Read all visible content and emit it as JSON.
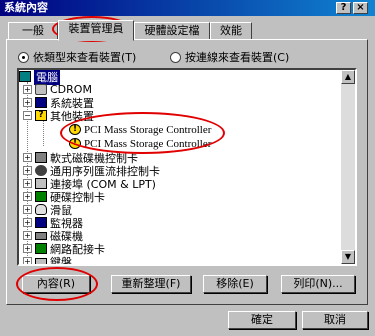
{
  "window": {
    "title": "系統內容",
    "help_btn": "?",
    "close_btn": "×"
  },
  "tabs": [
    "一般",
    "裝置管理員",
    "硬體設定檔",
    "效能"
  ],
  "view_options": [
    {
      "label": "依類型來查看裝置(T)",
      "selected": true
    },
    {
      "label": "按連線來查看裝置(C)",
      "selected": false
    }
  ],
  "tree": {
    "root": "電腦",
    "items": [
      {
        "label": "CDROM",
        "icon": "cdrom-icon",
        "expander": "+"
      },
      {
        "label": "系統裝置",
        "icon": "system-device-icon",
        "expander": "+"
      },
      {
        "label": "其他裝置",
        "icon": "question-device-icon",
        "expander": "−"
      },
      {
        "label": "PCI Mass Storage Controller",
        "icon": "warning-icon",
        "child": true
      },
      {
        "label": "PCI Mass Storage Controller",
        "icon": "warning-icon",
        "child": true
      },
      {
        "label": "軟式磁碟機控制卡",
        "icon": "floppy-controller-icon",
        "expander": "+"
      },
      {
        "label": "通用序列匯流排控制卡",
        "icon": "usb-icon",
        "expander": "+"
      },
      {
        "label": "連接埠 (COM & LPT)",
        "icon": "port-icon",
        "expander": "+"
      },
      {
        "label": "硬碟控制卡",
        "icon": "hdd-controller-icon",
        "expander": "+"
      },
      {
        "label": "滑鼠",
        "icon": "mouse-icon",
        "expander": "+"
      },
      {
        "label": "監視器",
        "icon": "monitor-icon",
        "expander": "+"
      },
      {
        "label": "磁碟機",
        "icon": "disk-icon",
        "expander": "+"
      },
      {
        "label": "網路配接卡",
        "icon": "network-icon",
        "expander": "+"
      },
      {
        "label": "鍵盤",
        "icon": "keyboard-icon",
        "expander": "+"
      }
    ]
  },
  "buttons": {
    "properties": "內容(R)",
    "refresh": "重新整理(F)",
    "remove": "移除(E)",
    "print": "列印(N)..."
  },
  "footer": {
    "ok": "確定",
    "cancel": "取消"
  },
  "colors": {
    "title_bar": "#000080",
    "selection": "#000080",
    "annotation": "#e00000"
  }
}
